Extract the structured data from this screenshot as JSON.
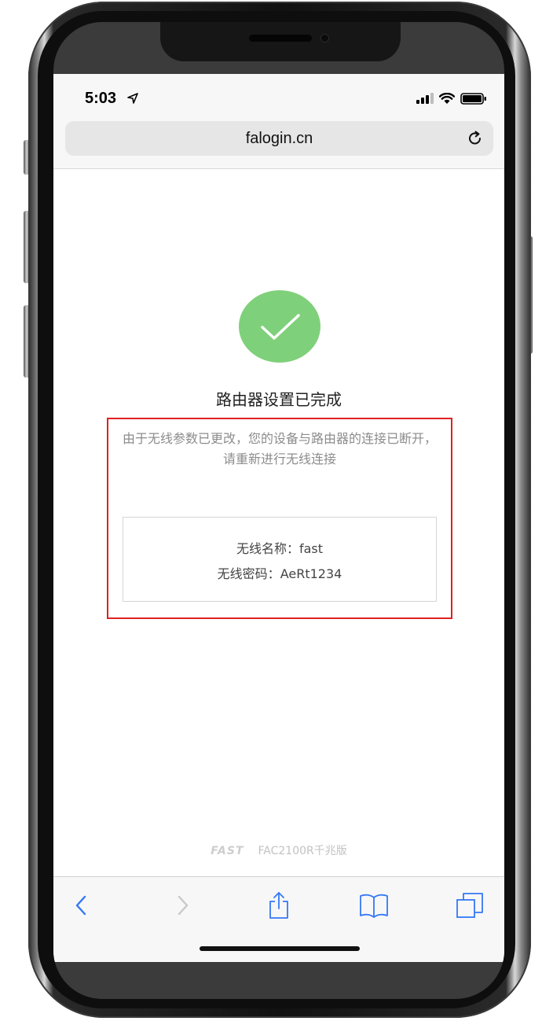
{
  "status_bar": {
    "time": "5:03"
  },
  "browser": {
    "url": "falogin.cn"
  },
  "page": {
    "title": "路由器设置已完成",
    "notice": "由于无线参数已更改，您的设备与路由器的连接已断开，请重新进行无线连接",
    "wifi_name_label": "无线名称：",
    "wifi_name_value": "fast",
    "wifi_password_label": "无线密码：",
    "wifi_password_value": "AeRt1234"
  },
  "footer": {
    "brand": "FAST",
    "model": "FAC2100R千兆版"
  },
  "icons": {
    "location": "location-arrow-icon",
    "signal": "signal-icon",
    "wifi": "wifi-icon",
    "battery": "battery-icon",
    "reload": "reload-icon",
    "check": "checkmark-icon",
    "back": "back-icon",
    "forward": "forward-icon",
    "share": "share-icon",
    "bookmarks": "bookmarks-icon",
    "tabs": "tabs-icon"
  },
  "colors": {
    "accent": "#3478f6",
    "success": "#7fd07a",
    "highlight_border": "#e02020"
  }
}
